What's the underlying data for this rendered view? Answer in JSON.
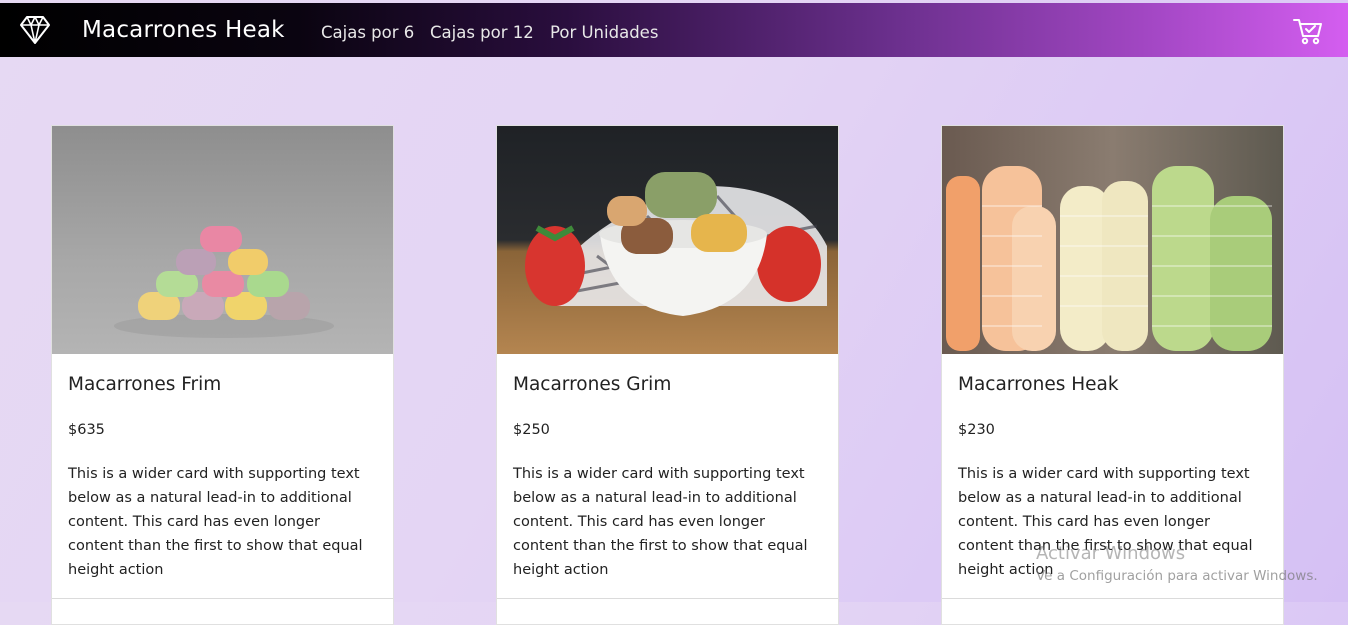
{
  "header": {
    "brand": "Macarrones Heak",
    "nav": [
      "Cajas por 6",
      "Cajas por 12",
      "Por Unidades"
    ],
    "logo_icon": "diamond-icon",
    "cart_icon": "shopping-cart-icon"
  },
  "cards": [
    {
      "title": "Macarrones Frim",
      "price": "$635",
      "text": "This is a wider card with supporting text below as a natural lead-in to additional content. This card has even longer content than the first to show that equal height action",
      "image": "macaron-pyramid-photo"
    },
    {
      "title": "Macarrones Grim",
      "price": "$250",
      "text": "This is a wider card with supporting text below as a natural lead-in to additional content. This card has even longer content than the first to show that equal height action",
      "image": "macarons-bowl-strawberries-photo"
    },
    {
      "title": "Macarrones Heak",
      "price": "$230",
      "text": "This is a wider card with supporting text below as a natural lead-in to additional content. This card has even longer content than the first to show that equal height action",
      "image": "macaron-rows-photo"
    }
  ],
  "watermark": {
    "title": "Activar Windows",
    "subtitle": "Ve a Configuración para activar Windows."
  },
  "colors": {
    "background": "#e4d5f4",
    "header_start": "#000000",
    "header_end": "#d45ef0",
    "card": "#ffffff",
    "text": "#222222"
  }
}
